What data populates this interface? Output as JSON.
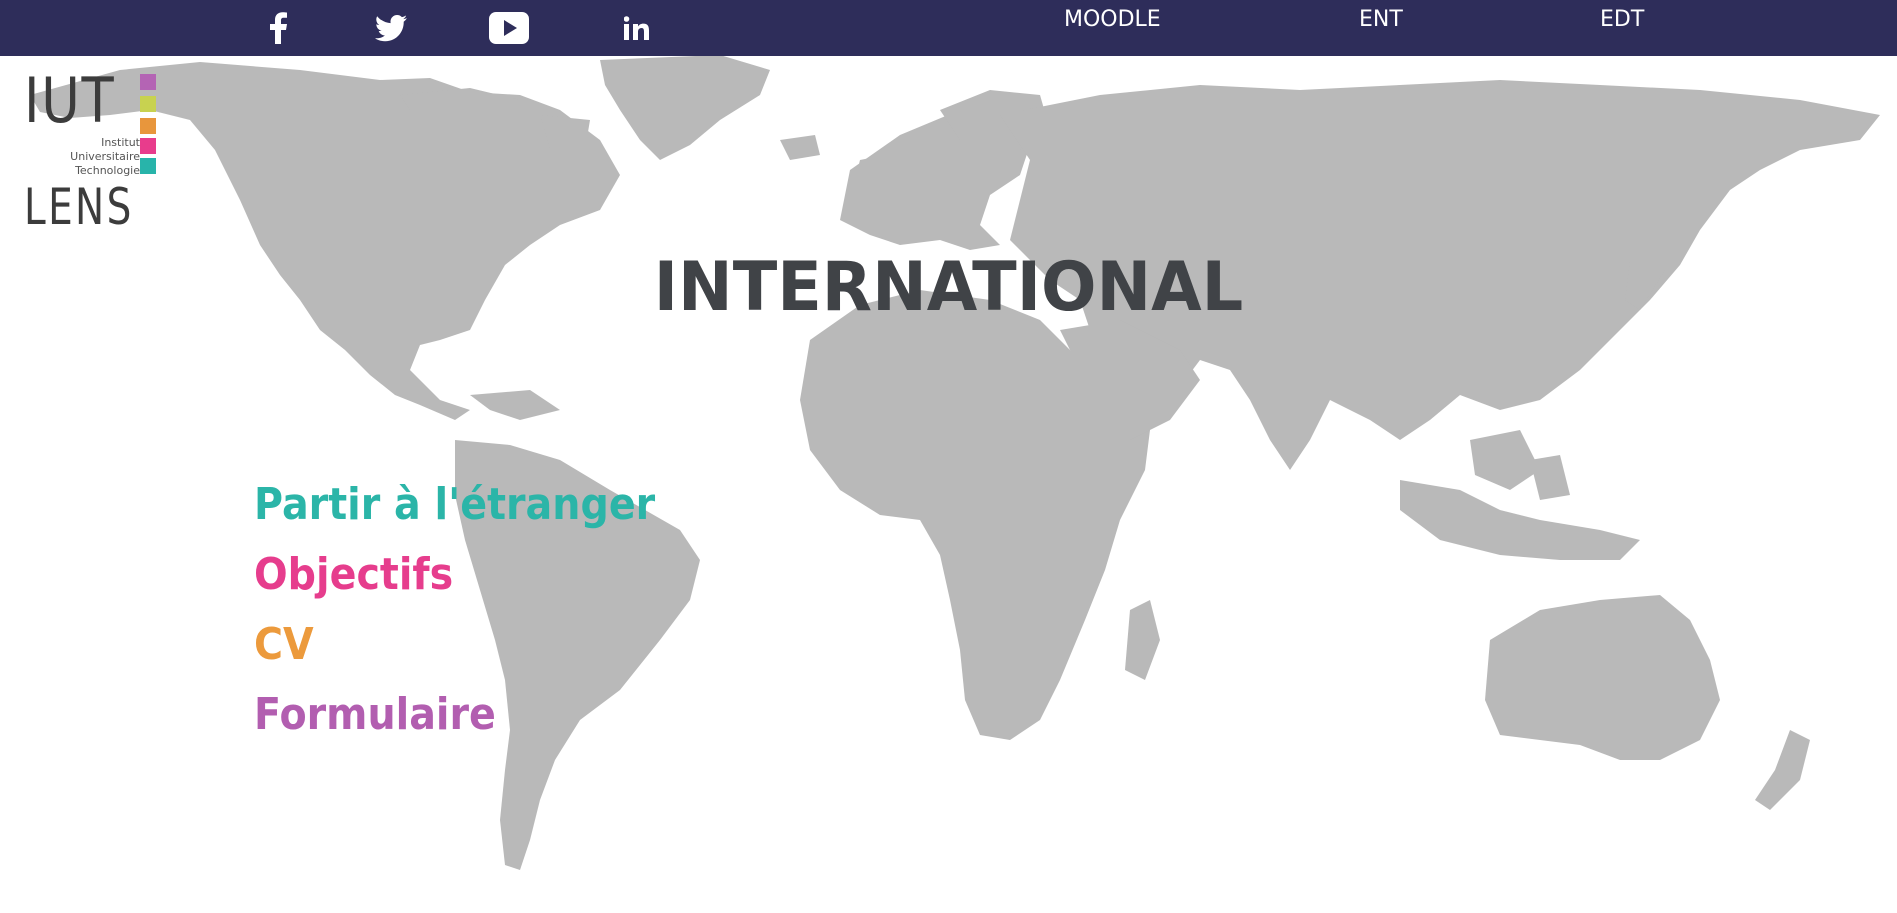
{
  "topbar": {
    "background": "#2e2d5a",
    "social": [
      {
        "icon": "facebook-icon"
      },
      {
        "icon": "twitter-icon"
      },
      {
        "icon": "youtube-icon"
      },
      {
        "icon": "linkedin-icon"
      }
    ],
    "links": [
      "MOODLE",
      "ENT",
      "EDT"
    ]
  },
  "logo": {
    "top": "IUT",
    "line1": "Institut",
    "line2": "Universitaire",
    "line3": "Technologie",
    "bottom": "LENS",
    "colors": [
      "#b464b4",
      "#c8d250",
      "#e8963c",
      "#e83c8c",
      "#28b4aa"
    ]
  },
  "title": "INTERNATIONAL",
  "menu": [
    {
      "label": "Partir à l'étranger",
      "color": "#2bb5a8"
    },
    {
      "label": "Objectifs",
      "color": "#e63d8d"
    },
    {
      "label": "CV",
      "color": "#ec9a3c"
    },
    {
      "label": "Formulaire",
      "color": "#b25eb0"
    }
  ],
  "map_color": "#b9b9b9"
}
